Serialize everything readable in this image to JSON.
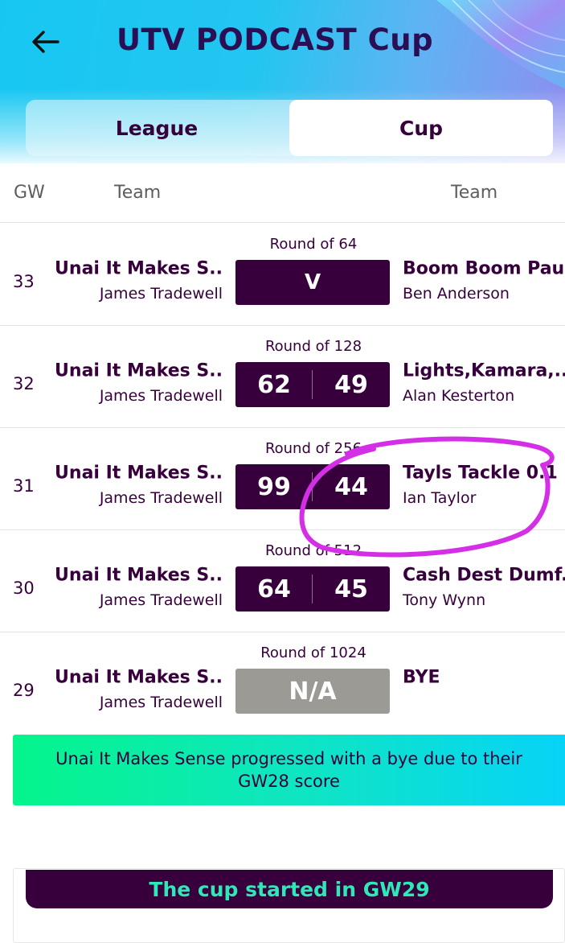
{
  "header": {
    "title": "UTV PODCAST Cup",
    "back_icon": "arrow-left-icon"
  },
  "tabs": [
    {
      "label": "League",
      "active": false
    },
    {
      "label": "Cup",
      "active": true
    }
  ],
  "columns": {
    "gw": "GW",
    "team_home": "Team",
    "team_away": "Team"
  },
  "fixtures": [
    {
      "round": "Round of 64",
      "gw": "33",
      "home_team": "Unai It Makes S..",
      "home_manager": "James Tradewell",
      "score_home": "",
      "score_away": "",
      "result_text": "V",
      "away_team": "Boom Boom Pau",
      "away_manager": "Ben Anderson"
    },
    {
      "round": "Round of 128",
      "gw": "32",
      "home_team": "Unai It Makes S..",
      "home_manager": "James Tradewell",
      "score_home": "62",
      "score_away": "49",
      "away_team": "Lights,Kamara,..",
      "away_manager": "Alan Kesterton"
    },
    {
      "round": "Round of 256",
      "gw": "31",
      "home_team": "Unai It Makes S..",
      "home_manager": "James Tradewell",
      "score_home": "99",
      "score_away": "44",
      "away_team": "Tayls Tackle 0.1",
      "away_manager": "Ian Taylor"
    },
    {
      "round": "Round of 512",
      "gw": "30",
      "home_team": "Unai It Makes S..",
      "home_manager": "James Tradewell",
      "score_home": "64",
      "score_away": "45",
      "away_team": "Cash Dest Dumf..",
      "away_manager": "Tony Wynn"
    },
    {
      "round": "Round of 1024",
      "gw": "29",
      "home_team": "Unai It Makes S..",
      "home_manager": "James Tradewell",
      "score_home": "",
      "score_away": "",
      "result_text": "N/A",
      "away_team": "BYE",
      "away_manager": ""
    }
  ],
  "bye_message": "Unai It Makes Sense progressed with a bye due to their GW28 score",
  "cup_started": "The cup started in GW29",
  "colors": {
    "primary": "#37003c",
    "header_cyan": "#17c7f2",
    "na_grey": "#9b9a95",
    "banner_green": "#04f58b",
    "banner_cyan": "#07d3f7",
    "started_text": "#2ee8b7",
    "annotation_magenta": "#d42ee6"
  }
}
